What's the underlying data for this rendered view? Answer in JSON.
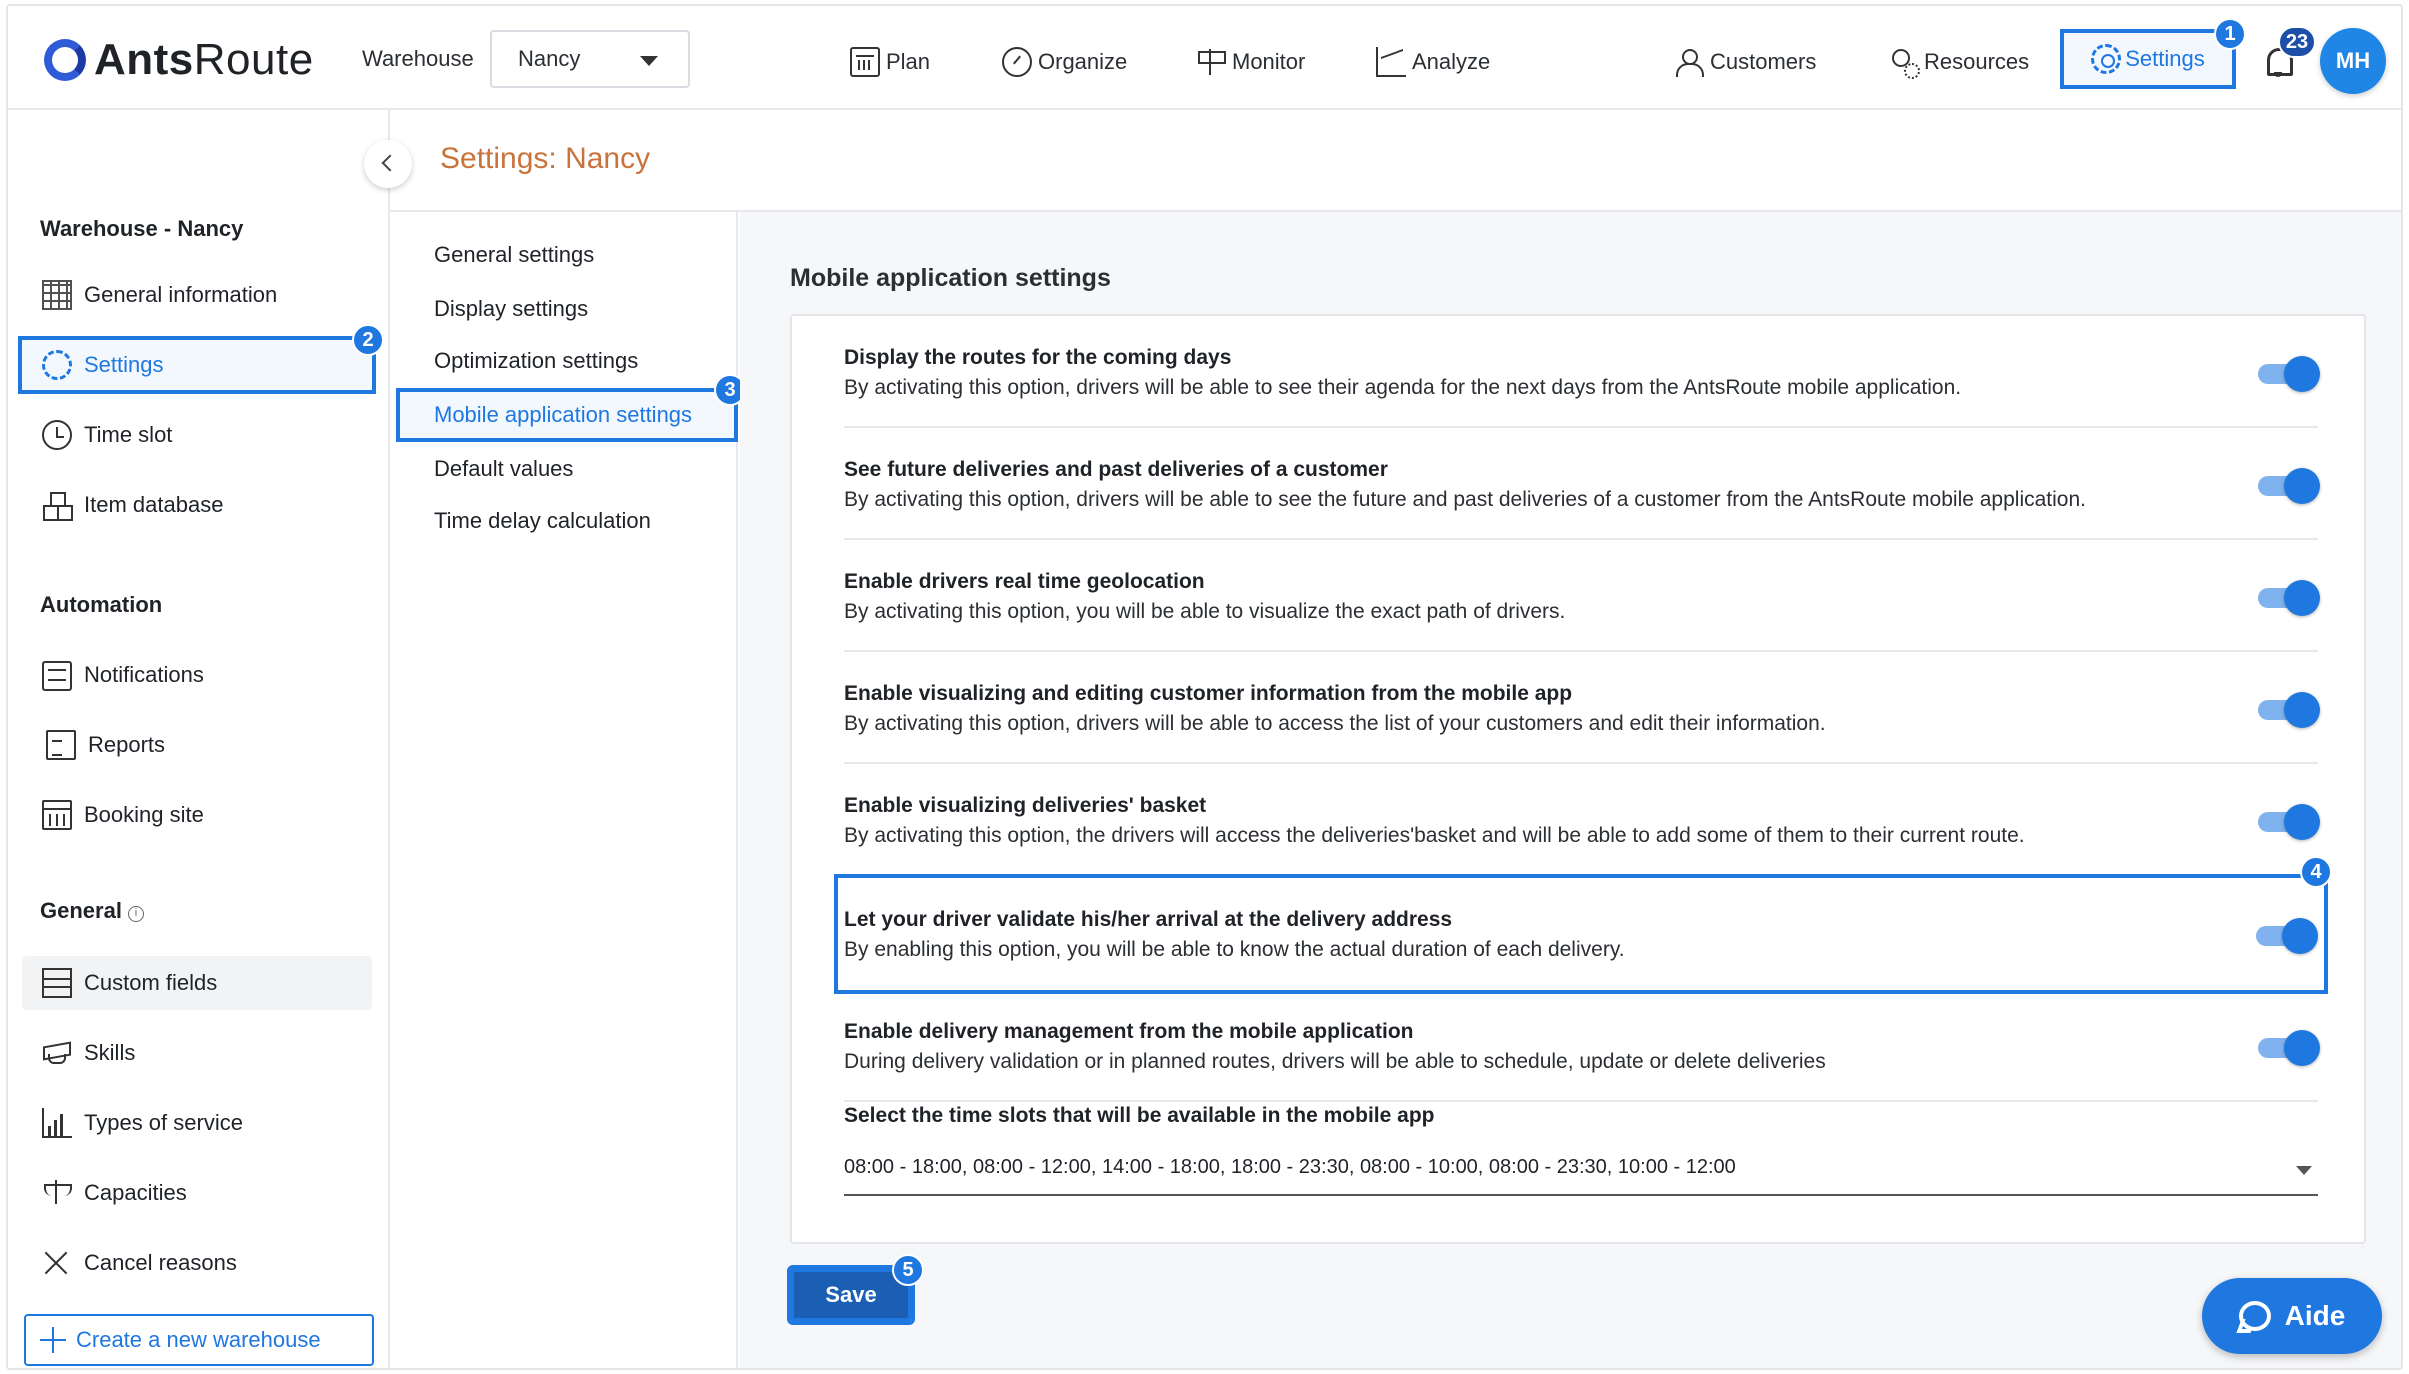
{
  "app": {
    "logo_prefix": "Ants",
    "logo_suffix": "Route",
    "warehouse_label": "Warehouse",
    "warehouse_selected": "Nancy"
  },
  "nav": {
    "plan": "Plan",
    "organize": "Organize",
    "monitor": "Monitor",
    "analyze": "Analyze",
    "customers": "Customers",
    "resources": "Resources",
    "settings": "Settings",
    "notifications_count": "23",
    "avatar_initials": "MH"
  },
  "steps": {
    "s1": "1",
    "s2": "2",
    "s3": "3",
    "s4": "4",
    "s5": "5"
  },
  "sidebar": {
    "section_warehouse": "Warehouse - Nancy",
    "general_information": "General information",
    "settings": "Settings",
    "time_slot": "Time slot",
    "item_database": "Item database",
    "section_automation": "Automation",
    "notifications": "Notifications",
    "reports": "Reports",
    "booking_site": "Booking site",
    "section_general": "General",
    "custom_fields": "Custom fields",
    "skills": "Skills",
    "types_of_service": "Types of service",
    "capacities": "Capacities",
    "cancel_reasons": "Cancel reasons",
    "create_warehouse": "Create a new warehouse"
  },
  "page": {
    "title": "Settings: Nancy"
  },
  "submenu": {
    "general": "General settings",
    "display": "Display settings",
    "optimization": "Optimization settings",
    "mobile": "Mobile application settings",
    "defaults": "Default values",
    "time_delay": "Time delay calculation"
  },
  "main": {
    "section_title": "Mobile application settings",
    "rows": [
      {
        "title": "Display the routes for the coming days",
        "desc": "By activating this option, drivers will be able to see their agenda for the next days from the AntsRoute mobile application.",
        "enabled": true
      },
      {
        "title": "See future deliveries and past deliveries of a customer",
        "desc": "By activating this option, drivers will be able to see the future and past deliveries of a customer from the AntsRoute mobile application.",
        "enabled": true
      },
      {
        "title": "Enable drivers real time geolocation",
        "desc": "By activating this option, you will be able to visualize the exact path of drivers.",
        "enabled": true
      },
      {
        "title": "Enable visualizing and editing customer information from the mobile app",
        "desc": "By activating this option, drivers will be able to access the list of your customers and edit their information.",
        "enabled": true
      },
      {
        "title": "Enable visualizing deliveries' basket",
        "desc": "By activating this option, the drivers will access the deliveries'basket and will be able to add some of them to their current route.",
        "enabled": true
      },
      {
        "title": "Let your driver validate his/her arrival at the delivery address",
        "desc": "By enabling this option, you will be able to know the actual duration of each delivery.",
        "enabled": true
      },
      {
        "title": "Enable delivery management from the mobile application",
        "desc": "During delivery validation or in planned routes, drivers will be able to schedule, update or delete deliveries",
        "enabled": true
      }
    ],
    "time_slots_label": "Select the time slots that will be available in the mobile app",
    "time_slots_value": "08:00 - 18:00, 08:00 - 12:00, 14:00 - 18:00, 18:00 - 23:30, 08:00 - 10:00, 08:00 - 23:30, 10:00 - 12:00",
    "save_label": "Save"
  },
  "aide": {
    "label": "Aide"
  },
  "colors": {
    "accent": "#1f77e0",
    "title": "#c9733b",
    "save": "#1a5fb4"
  }
}
